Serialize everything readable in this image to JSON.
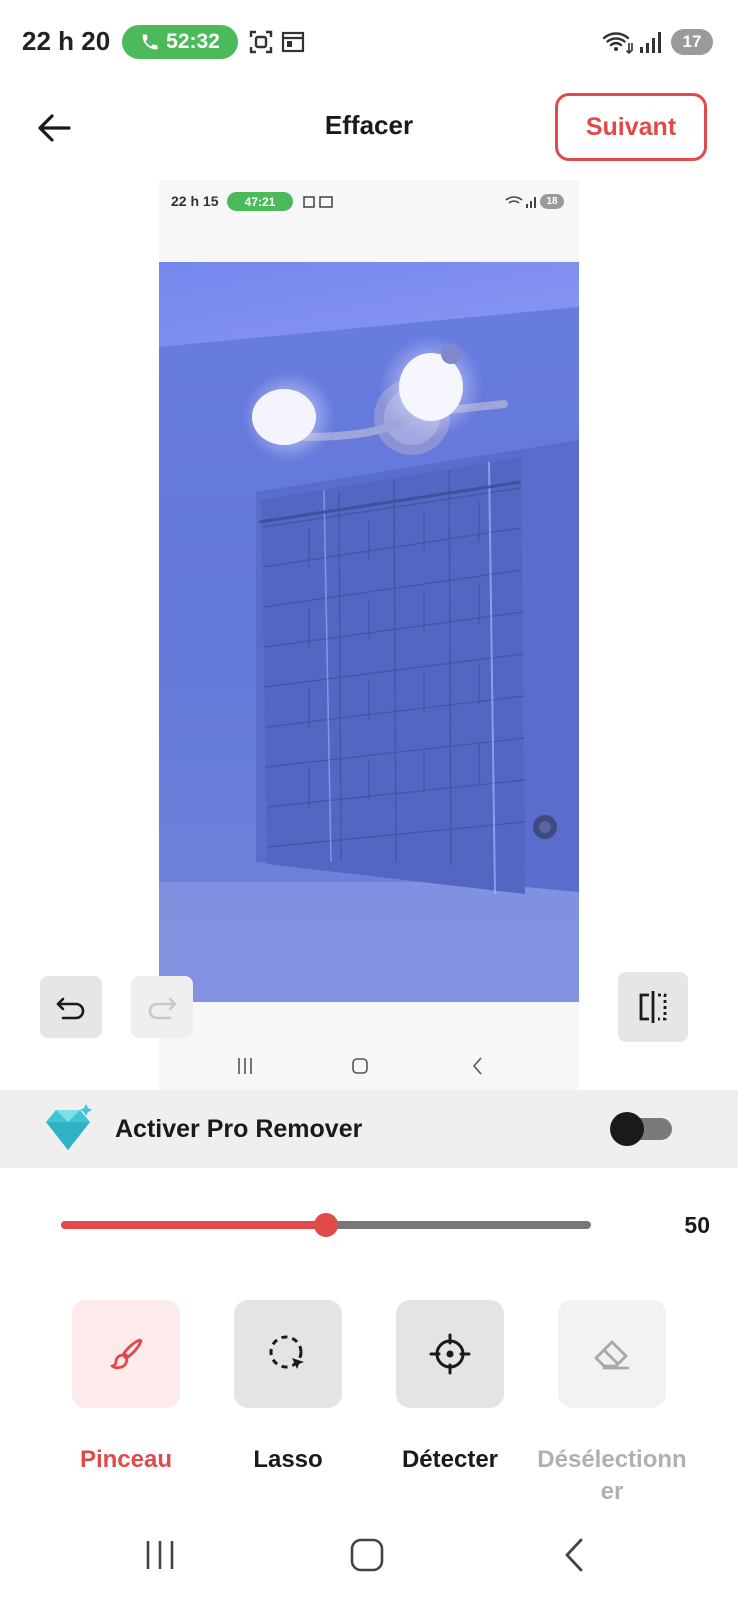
{
  "status_bar": {
    "time": "22 h 20",
    "call_timer": "52:32",
    "battery": "17"
  },
  "header": {
    "title": "Effacer",
    "next_label": "Suivant"
  },
  "preview": {
    "inner_time": "22 h 15",
    "inner_call_timer": "47:21",
    "inner_battery": "18"
  },
  "pro_remover": {
    "label": "Activer Pro Remover",
    "enabled": false,
    "icon": "diamond-icon",
    "icon_color": "#3fc6d6"
  },
  "brush_size": {
    "value": "50",
    "fraction": 0.5
  },
  "tools": [
    {
      "label": "Pinceau",
      "icon": "brush-icon",
      "active": true
    },
    {
      "label": "Lasso",
      "icon": "lasso-icon",
      "active": false
    },
    {
      "label": "Détecter",
      "icon": "target-icon",
      "active": false
    },
    {
      "label": "Désélectionner",
      "icon": "eraser-icon",
      "disabled": true
    }
  ],
  "colors": {
    "accent": "#e24a4a",
    "call_green": "#4cb95a"
  }
}
